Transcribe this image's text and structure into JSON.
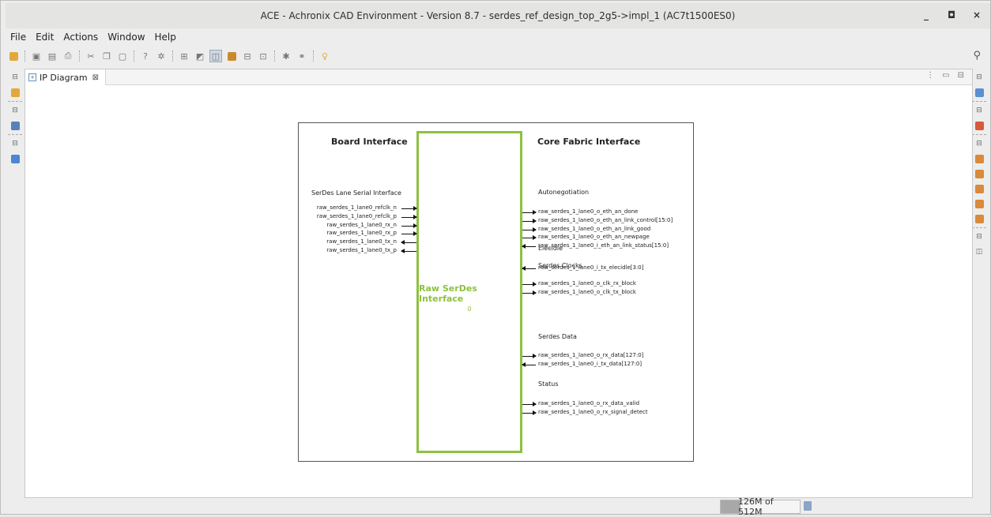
{
  "window": {
    "title": "ACE - Achronix CAD Environment - Version 8.7 - serdes_ref_design_top_2g5->impl_1 (AC7t1500ES0)",
    "controls": {
      "minimize": "_",
      "maximize": "◘",
      "close": "×"
    }
  },
  "menu": {
    "items": [
      "File",
      "Edit",
      "Actions",
      "Window",
      "Help"
    ]
  },
  "editor": {
    "tab_label": "IP Diagram",
    "tab_close": "⊠"
  },
  "diagram": {
    "left_header": "Board Interface",
    "right_header": "Core Fabric Interface",
    "core_label": "Raw SerDes Interface",
    "core_sub": "0",
    "left_section": "SerDes Lane Serial Interface",
    "left_signals": [
      {
        "name": "raw_serdes_1_lane0_refclk_n",
        "dir": "in"
      },
      {
        "name": "raw_serdes_1_lane0_refclk_p",
        "dir": "in"
      },
      {
        "name": "raw_serdes_1_lane0_rx_n",
        "dir": "in"
      },
      {
        "name": "raw_serdes_1_lane0_rx_p",
        "dir": "in"
      },
      {
        "name": "raw_serdes_1_lane0_tx_n",
        "dir": "out"
      },
      {
        "name": "raw_serdes_1_lane0_tx_p",
        "dir": "out"
      }
    ],
    "right_sections": [
      {
        "title": "Autonegotiation",
        "signals": [
          {
            "name": "raw_serdes_1_lane0_o_eth_an_done",
            "dir": "out"
          },
          {
            "name": "raw_serdes_1_lane0_o_eth_an_link_control[15:0]",
            "dir": "out"
          },
          {
            "name": "raw_serdes_1_lane0_o_eth_an_link_good",
            "dir": "out"
          },
          {
            "name": "raw_serdes_1_lane0_o_eth_an_newpage",
            "dir": "out"
          },
          {
            "name": "raw_serdes_1_lane0_i_eth_an_link_status[15:0]",
            "dir": "in"
          }
        ]
      },
      {
        "title": "Elecidle",
        "signals": [
          {
            "name": "raw_serdes_1_lane0_i_tx_elecidle[3:0]",
            "dir": "in"
          }
        ]
      },
      {
        "title": "Serdes Clocks",
        "signals": [
          {
            "name": "raw_serdes_1_lane0_o_clk_rx_block",
            "dir": "out"
          },
          {
            "name": "raw_serdes_1_lane0_o_clk_tx_block",
            "dir": "out"
          }
        ]
      },
      {
        "title": "Serdes Data",
        "signals": [
          {
            "name": "raw_serdes_1_lane0_o_rx_data[127:0]",
            "dir": "out"
          },
          {
            "name": "raw_serdes_1_lane0_i_tx_data[127:0]",
            "dir": "in"
          }
        ]
      },
      {
        "title": "Status",
        "signals": [
          {
            "name": "raw_serdes_1_lane0_o_rx_data_valid",
            "dir": "out"
          },
          {
            "name": "raw_serdes_1_lane0_o_rx_signal_detect",
            "dir": "out"
          }
        ]
      }
    ]
  },
  "status": {
    "memory": "126M of 512M",
    "memory_fraction": 0.25
  },
  "colors": {
    "accent_green": "#8dc13f",
    "tile_orange": "#d98a3a"
  },
  "icons": {
    "toolbar": [
      "open-folder-icon",
      "save-icon",
      "save-all-icon",
      "print-icon",
      "cut-icon",
      "copy-icon",
      "paste-icon",
      "help-icon",
      "settings-icon",
      "layout-icon",
      "view-icon",
      "view-active-icon",
      "grid-icon",
      "tree-icon",
      "comment-icon",
      "bug-icon",
      "link-icon",
      "tip-icon"
    ]
  }
}
